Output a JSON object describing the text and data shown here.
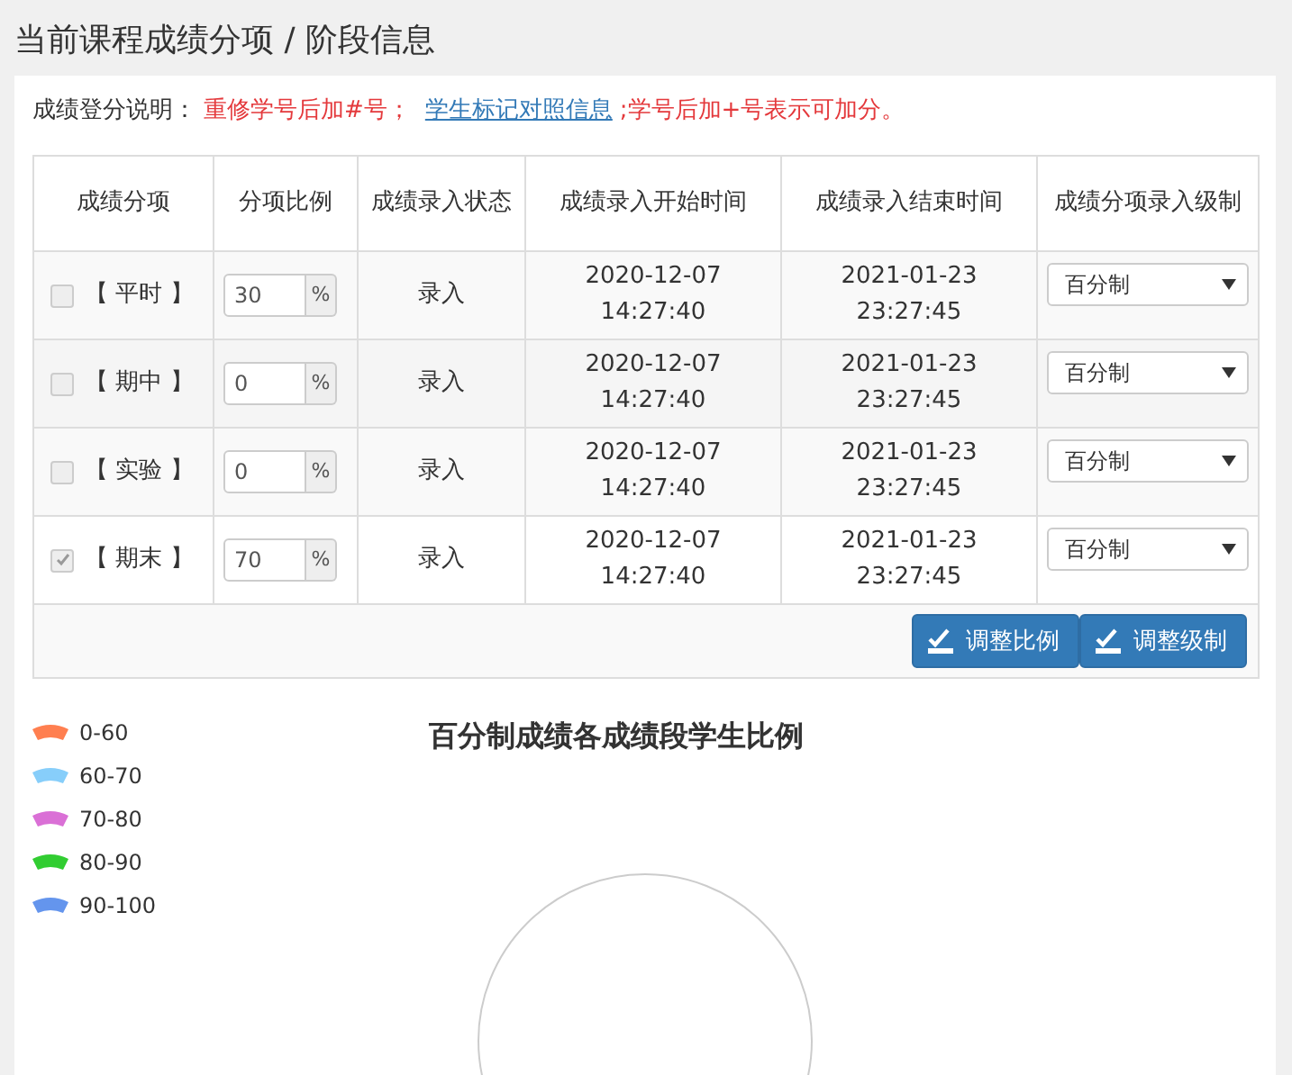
{
  "page_title": "当前课程成绩分项 / 阶段信息",
  "notice": {
    "label": "成绩登分说明：",
    "rule": "重修学号后加#号；",
    "link": "学生标记对照信息",
    "tail": ";学号后加+号表示可加分。"
  },
  "table": {
    "columns": [
      "成绩分项",
      "分项比例",
      "成绩录入状态",
      "成绩录入开始时间",
      "成绩录入结束时间",
      "成绩分项录入级制"
    ],
    "rows": [
      {
        "checked": false,
        "name": "【 平时 】",
        "ratio": "30",
        "unit": "%",
        "status": "录入",
        "start": "2020-12-07 14:27:40",
        "end": "2021-01-23 23:27:45",
        "grade": "百分制"
      },
      {
        "checked": false,
        "name": "【 期中 】",
        "ratio": "0",
        "unit": "%",
        "status": "录入",
        "start": "2020-12-07 14:27:40",
        "end": "2021-01-23 23:27:45",
        "grade": "百分制"
      },
      {
        "checked": false,
        "name": "【 实验 】",
        "ratio": "0",
        "unit": "%",
        "status": "录入",
        "start": "2020-12-07 14:27:40",
        "end": "2021-01-23 23:27:45",
        "grade": "百分制"
      },
      {
        "checked": true,
        "name": "【 期末 】",
        "ratio": "70",
        "unit": "%",
        "status": "录入",
        "start": "2020-12-07 14:27:40",
        "end": "2021-01-23 23:27:45",
        "grade": "百分制"
      }
    ],
    "buttons": [
      "调整比例",
      "调整级制"
    ]
  },
  "chart": {
    "title": "百分制成绩各成绩段学生比例",
    "legend": [
      {
        "label": "0-60",
        "color": "#ff7f50"
      },
      {
        "label": "60-70",
        "color": "#87cefa"
      },
      {
        "label": "70-80",
        "color": "#da70d6"
      },
      {
        "label": "80-90",
        "color": "#32cd32"
      },
      {
        "label": "90-100",
        "color": "#6495ed"
      }
    ]
  }
}
